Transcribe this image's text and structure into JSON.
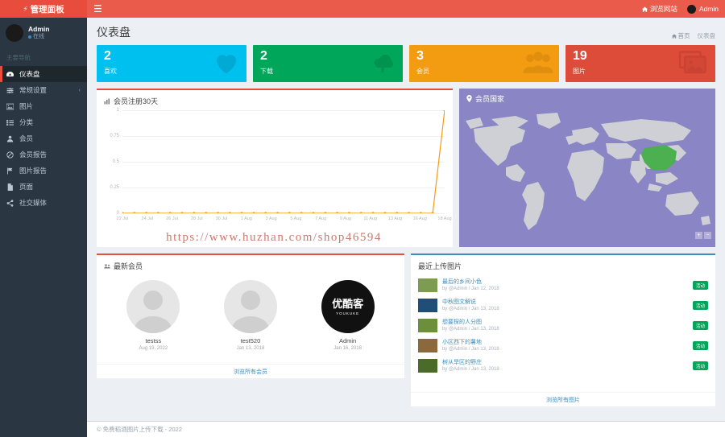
{
  "brand": {
    "title": "管理面板",
    "icon": "bolt-icon"
  },
  "navbar": {
    "hamburger": "☰",
    "site_link": "浏览网站",
    "user_label": "Admin"
  },
  "sidebar": {
    "user": {
      "name": "Admin",
      "status": "在线"
    },
    "menu_header": "主要导航",
    "items": [
      {
        "label": "仪表盘",
        "icon": "dashboard-icon",
        "active": true
      },
      {
        "label": "常规设置",
        "icon": "sliders-icon",
        "caret": "‹"
      },
      {
        "label": "图片",
        "icon": "image-icon"
      },
      {
        "label": "分类",
        "icon": "list-icon"
      },
      {
        "label": "会员",
        "icon": "user-icon"
      },
      {
        "label": "会员报告",
        "icon": "ban-icon"
      },
      {
        "label": "图片报告",
        "icon": "flag-icon"
      },
      {
        "label": "页面",
        "icon": "file-icon"
      },
      {
        "label": "社交媒体",
        "icon": "share-icon"
      }
    ]
  },
  "page": {
    "title": "仪表盘",
    "breadcrumb": [
      {
        "label": "首页",
        "icon": "home-icon"
      },
      {
        "label": "仪表盘",
        "icon": ""
      }
    ]
  },
  "cards": [
    {
      "value": "2",
      "label": "喜欢",
      "color": "#00c0ef",
      "icon": "heart-icon"
    },
    {
      "value": "2",
      "label": "下载",
      "color": "#00a65a",
      "icon": "cloud-upload-icon"
    },
    {
      "value": "3",
      "label": "会员",
      "color": "#f39c12",
      "icon": "users-icon"
    },
    {
      "value": "19",
      "label": "图片",
      "color": "#dd4b39",
      "icon": "images-icon"
    }
  ],
  "chart_panel": {
    "title": "会员注册30天",
    "icon": "bar-chart-icon"
  },
  "chart_data": {
    "type": "line",
    "title": "会员注册30天",
    "xlabel": "",
    "ylabel": "",
    "ylim": [
      0,
      1
    ],
    "yticks": [
      "0",
      "0.25",
      "0.5",
      "0.75",
      "1"
    ],
    "grid": true,
    "legend": "none",
    "x": [
      "22 Jul",
      "23 Jul",
      "24 Jul",
      "25 Jul",
      "26 Jul",
      "27 Jul",
      "28 Jul",
      "29 Jul",
      "30 Jul",
      "31 Jul",
      "1 Aug",
      "2 Aug",
      "3 Aug",
      "4 Aug",
      "5 Aug",
      "6 Aug",
      "7 Aug",
      "8 Aug",
      "9 Aug",
      "10 Aug",
      "11 Aug",
      "12 Aug",
      "13 Aug",
      "14 Aug",
      "15 Aug",
      "16 Aug",
      "17 Aug",
      "18 Aug"
    ],
    "xtick_labels": [
      "22 Jul",
      "24 Jul",
      "26 Jul",
      "28 Jul",
      "30 Jul",
      "1 Aug",
      "3 Aug",
      "5 Aug",
      "7 Aug",
      "9 Aug",
      "11 Aug",
      "13 Aug",
      "16 Aug",
      "18 Aug"
    ],
    "series": [
      {
        "name": "注册",
        "color": "#f39c12",
        "values": [
          0,
          0,
          0,
          0,
          0,
          0,
          0,
          0,
          0,
          0,
          0,
          0,
          0,
          0,
          0,
          0,
          0,
          0,
          0,
          0,
          0,
          0,
          0,
          0,
          0,
          0,
          0,
          1
        ]
      }
    ]
  },
  "watermark": "https://www.huzhan.com/shop46594",
  "map_panel": {
    "title": "会员国家",
    "icon": "map-marker-icon",
    "zoom_in": "+",
    "zoom_out": "−",
    "highlight_color": "#4caf50"
  },
  "members_panel": {
    "title": "最新会员",
    "icon": "users-icon",
    "footer_link": "浏览所有会员",
    "members": [
      {
        "name": "testss",
        "date": "Aug 19, 2022",
        "avatar": "placeholder"
      },
      {
        "name": "test520",
        "date": "Jan 13, 2018",
        "avatar": "placeholder"
      },
      {
        "name": "Admin",
        "date": "Jan 16, 2018",
        "avatar": "优酷客",
        "avatar_sub": "YOUKUKE"
      }
    ]
  },
  "images_panel": {
    "title": "最近上传图片",
    "footer_link": "浏览所有图片",
    "rows": [
      {
        "title": "最后的乡间小色",
        "sub": "by @Admin / Jan 12, 2018",
        "badge": "活动",
        "thumb": "#7d9b52"
      },
      {
        "title": "中秋图文解说",
        "sub": "by @Admin / Jan 13, 2018",
        "badge": "活动",
        "thumb": "#1f4e79"
      },
      {
        "title": "想要探的人分图",
        "sub": "by @Admin / Jan 13, 2018",
        "badge": "活动",
        "thumb": "#6b8f3a"
      },
      {
        "title": "小区西下的薯地",
        "sub": "by @Admin / Jan 13, 2018",
        "badge": "活动",
        "thumb": "#8a6a3c"
      },
      {
        "title": "树从旱区的野庄",
        "sub": "by @Admin / Jan 13, 2018",
        "badge": "活动",
        "thumb": "#4a6b2a"
      }
    ]
  },
  "footer": {
    "text": "© 免费稻酒图片上传下载 - 2022"
  }
}
